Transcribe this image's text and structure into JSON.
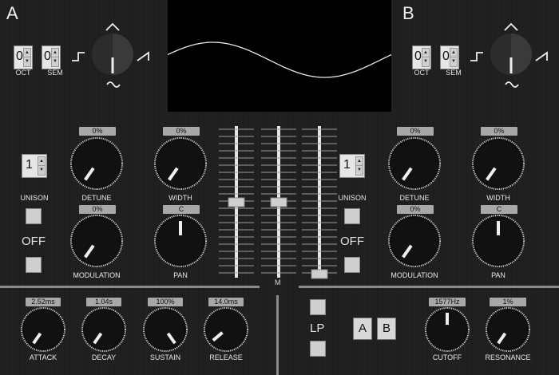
{
  "osc_a": {
    "letter": "A",
    "oct": {
      "value": "0",
      "label": "OCT"
    },
    "sem": {
      "value": "0",
      "label": "SEM"
    },
    "unison": {
      "value": "1",
      "label": "UNISON"
    },
    "detune": {
      "value": "0%",
      "label": "DETUNE"
    },
    "width": {
      "value": "0%",
      "label": "WIDTH"
    },
    "modulation": {
      "value": "0%",
      "label": "MODULATION"
    },
    "pan": {
      "value": "C",
      "label": "PAN"
    },
    "off_label": "OFF"
  },
  "osc_b": {
    "letter": "B",
    "oct": {
      "value": "0",
      "label": "OCT"
    },
    "sem": {
      "value": "0",
      "label": "SEM"
    },
    "unison": {
      "value": "1",
      "label": "UNISON"
    },
    "detune": {
      "value": "0%",
      "label": "DETUNE"
    },
    "width": {
      "value": "0%",
      "label": "WIDTH"
    },
    "modulation": {
      "value": "0%",
      "label": "MODULATION"
    },
    "pan": {
      "value": "C",
      "label": "PAN"
    },
    "off_label": "OFF"
  },
  "mixer": {
    "master_label": "M"
  },
  "envelope": {
    "attack": {
      "value": "2.52ms",
      "label": "ATTACK"
    },
    "decay": {
      "value": "1.04s",
      "label": "DECAY"
    },
    "sustain": {
      "value": "100%",
      "label": "SUSTAIN"
    },
    "release": {
      "value": "14.0ms",
      "label": "RELEASE"
    }
  },
  "filter": {
    "type_label": "LP",
    "route_a": "A",
    "route_b": "B",
    "cutoff": {
      "value": "1577Hz",
      "label": "CUTOFF"
    },
    "resonance": {
      "value": "1%",
      "label": "RESONANCE"
    }
  }
}
